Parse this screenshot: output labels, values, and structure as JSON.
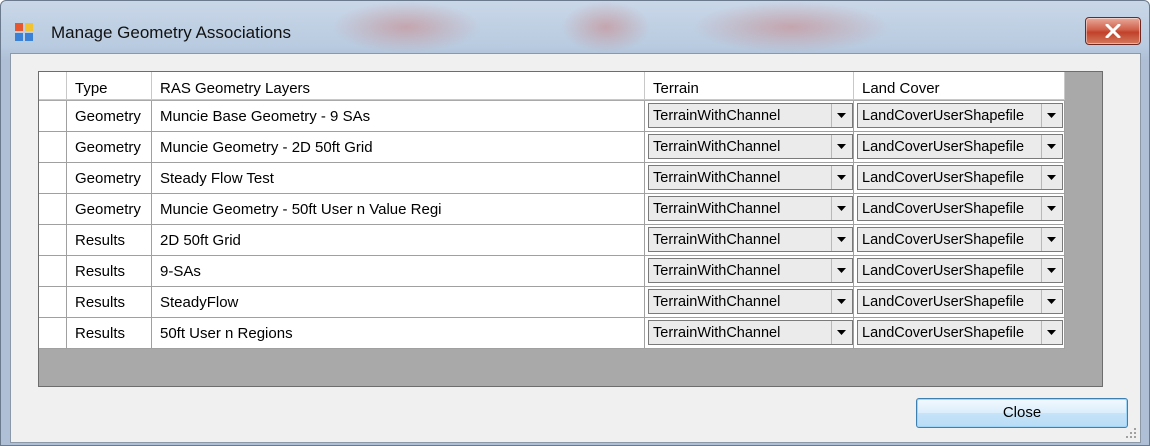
{
  "window": {
    "title": "Manage Geometry Associations",
    "icon": "app-window-icon",
    "close_icon": "close-x-icon"
  },
  "grid": {
    "columns": [
      "Type",
      "RAS Geometry Layers",
      "Terrain",
      "Land Cover"
    ],
    "rows": [
      {
        "type": "Geometry",
        "layer": "Muncie Base Geometry - 9 SAs",
        "terrain": "TerrainWithChannel",
        "landcover": "LandCoverUserShapefile"
      },
      {
        "type": "Geometry",
        "layer": "Muncie Geometry - 2D 50ft Grid",
        "terrain": "TerrainWithChannel",
        "landcover": "LandCoverUserShapefile"
      },
      {
        "type": "Geometry",
        "layer": "Steady Flow Test",
        "terrain": "TerrainWithChannel",
        "landcover": "LandCoverUserShapefile"
      },
      {
        "type": "Geometry",
        "layer": "Muncie Geometry - 50ft User n Value Regi",
        "terrain": "TerrainWithChannel",
        "landcover": "LandCoverUserShapefile"
      },
      {
        "type": "Results",
        "layer": "2D 50ft Grid",
        "terrain": "TerrainWithChannel",
        "landcover": "LandCoverUserShapefile"
      },
      {
        "type": "Results",
        "layer": "9-SAs",
        "terrain": "TerrainWithChannel",
        "landcover": "LandCoverUserShapefile"
      },
      {
        "type": "Results",
        "layer": "SteadyFlow",
        "terrain": "TerrainWithChannel",
        "landcover": "LandCoverUserShapefile"
      },
      {
        "type": "Results",
        "layer": "50ft User n Regions",
        "terrain": "TerrainWithChannel",
        "landcover": "LandCoverUserShapefile"
      }
    ]
  },
  "footer": {
    "close_label": "Close"
  },
  "colors": {
    "grid_background": "#a9a9a9",
    "close_button_border": "#3c7fb1",
    "title_close_red": "#c1412a"
  }
}
